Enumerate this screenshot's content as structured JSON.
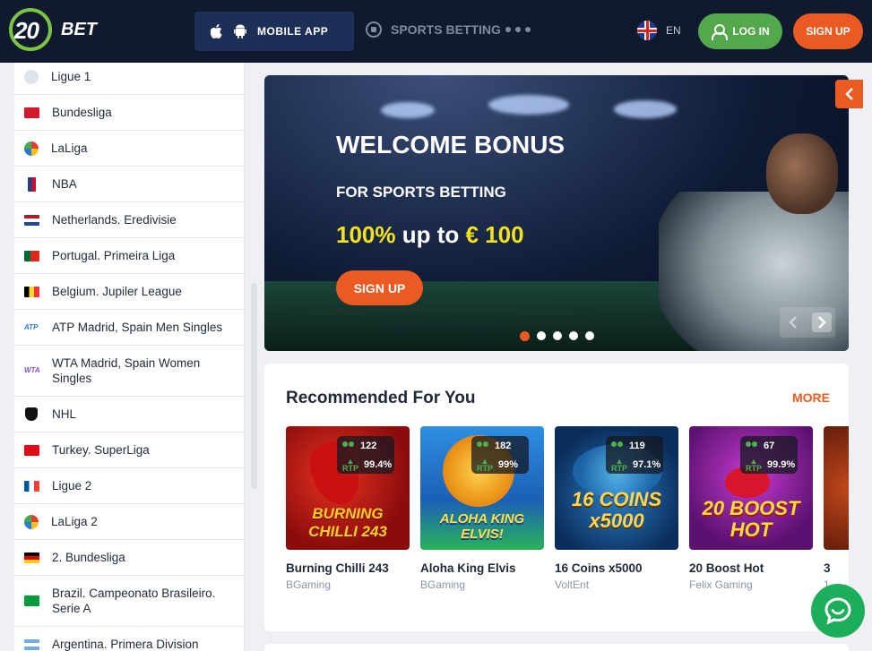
{
  "header": {
    "logo": "20 BET",
    "mobile_app": "MOBILE APP",
    "sports_betting": "SPORTS BETTING",
    "lang": "EN",
    "login": "LOG IN",
    "signup": "SIGN UP"
  },
  "sidebar": {
    "items": [
      {
        "label": "Ligue 1",
        "icon": "ligue1-icon"
      },
      {
        "label": "Bundesliga",
        "icon": "bundesliga-icon"
      },
      {
        "label": "LaLiga",
        "icon": "laliga-icon"
      },
      {
        "label": "NBA",
        "icon": "nba-icon"
      },
      {
        "label": "Netherlands. Eredivisie",
        "icon": "netherlands-flag-icon"
      },
      {
        "label": "Portugal. Primeira Liga",
        "icon": "portugal-flag-icon"
      },
      {
        "label": "Belgium. Jupiler League",
        "icon": "belgium-flag-icon"
      },
      {
        "label": "ATP Madrid, Spain Men Singles",
        "icon": "atp-icon"
      },
      {
        "label": "WTA Madrid, Spain Women Singles",
        "icon": "wta-icon"
      },
      {
        "label": "NHL",
        "icon": "nhl-icon"
      },
      {
        "label": "Turkey. SuperLiga",
        "icon": "turkey-flag-icon"
      },
      {
        "label": "Ligue 2",
        "icon": "france-flag-icon"
      },
      {
        "label": "LaLiga 2",
        "icon": "laliga2-icon"
      },
      {
        "label": "2. Bundesliga",
        "icon": "germany-flag-icon"
      },
      {
        "label": "Brazil. Campeonato Brasileiro. Serie A",
        "icon": "brazil-flag-icon"
      },
      {
        "label": "Argentina. Primera Division",
        "icon": "argentina-flag-icon"
      }
    ]
  },
  "banner": {
    "title": "WELCOME BONUS",
    "subtitle": "FOR SPORTS BETTING",
    "offer_pct": "100%",
    "offer_mid": "up to",
    "offer_amount": "€ 100",
    "cta": "SIGN UP",
    "slides": 5,
    "active_slide": 1
  },
  "recommended": {
    "title": "Recommended For You",
    "more": "MORE",
    "games": [
      {
        "name": "Burning Chilli 243",
        "provider": "BGaming",
        "players": "122",
        "rtp": "99.4%",
        "thumb_title": "BURNING CHILLI 243"
      },
      {
        "name": "Aloha King Elvis",
        "provider": "BGaming",
        "players": "182",
        "rtp": "99%",
        "thumb_title": "ALOHA KING ELVIS!"
      },
      {
        "name": "16 Coins x5000",
        "provider": "VoltEnt",
        "players": "119",
        "rtp": "97.1%",
        "thumb_title": "16 COINS x5000"
      },
      {
        "name": "20 Boost Hot",
        "provider": "Felix Gaming",
        "players": "67",
        "rtp": "99.9%",
        "thumb_title": "20 BOOST HOT"
      },
      {
        "name": "3",
        "provider": "1",
        "players": "",
        "rtp": "",
        "thumb_title": ""
      }
    ],
    "rtp_label": "RTP"
  },
  "colors": {
    "accent": "#ea5a22",
    "green": "#52a84a",
    "header_bg": "#0f1a2e"
  }
}
